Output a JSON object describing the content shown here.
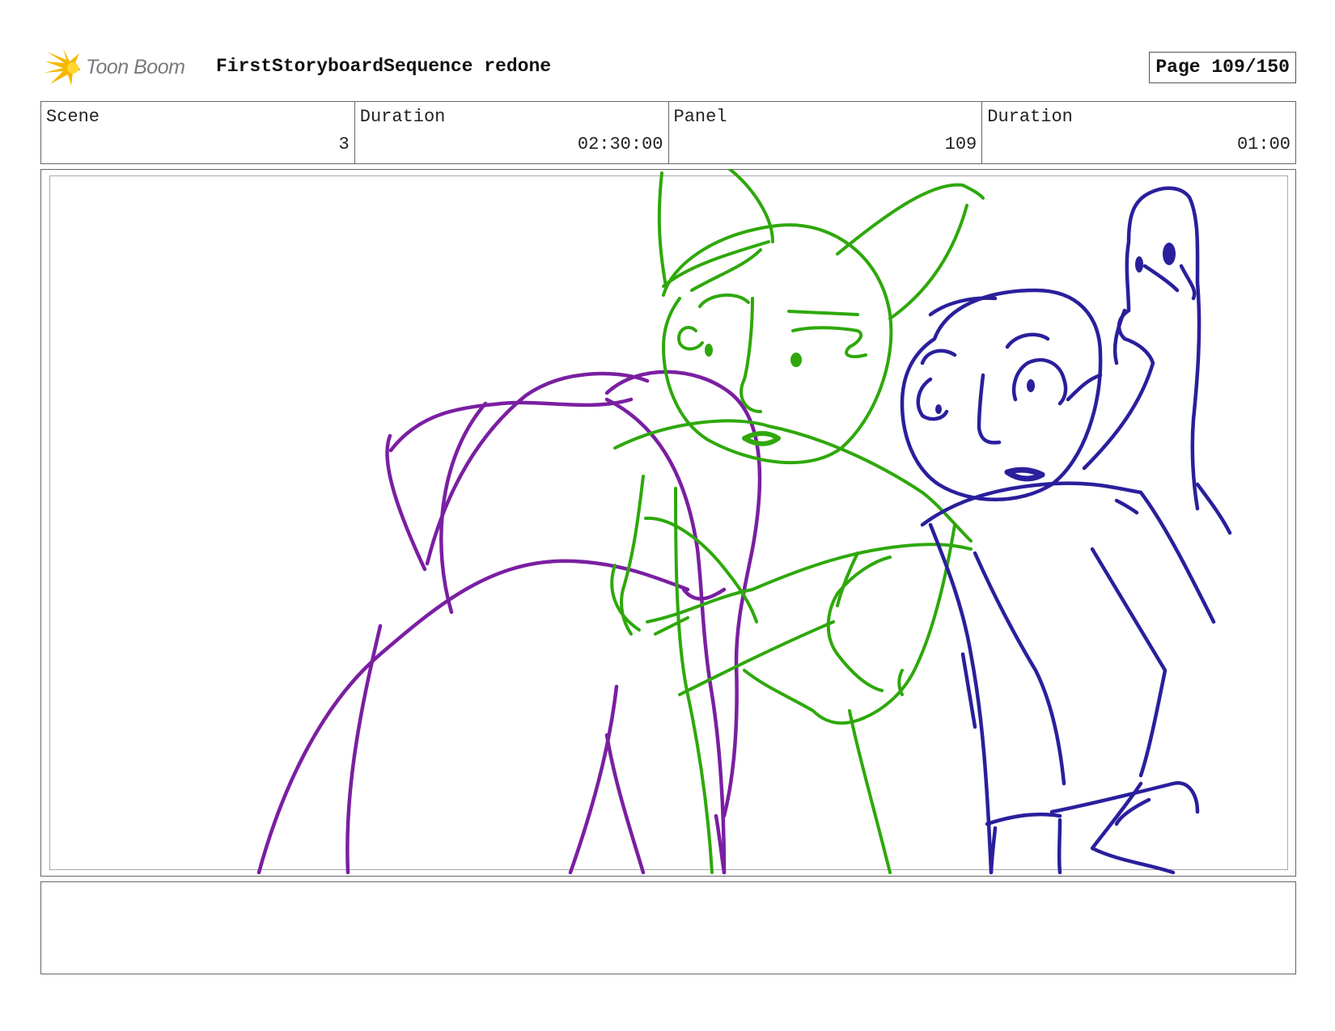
{
  "header": {
    "logo_text": "Toon Boom",
    "project_title": "FirstStoryboardSequence redone",
    "page_indicator": "Page 109/150"
  },
  "info": {
    "scene_label": "Scene",
    "scene_value": "3",
    "scene_duration_label": "Duration",
    "scene_duration_value": "02:30:00",
    "panel_label": "Panel",
    "panel_value": "109",
    "panel_duration_label": "Duration",
    "panel_duration_value": "01:00"
  },
  "sketch": {
    "colors": {
      "purple": "#7a1fa2",
      "green": "#2ea80b",
      "blue": "#2a1f9c"
    }
  },
  "notes": {
    "text": ""
  }
}
